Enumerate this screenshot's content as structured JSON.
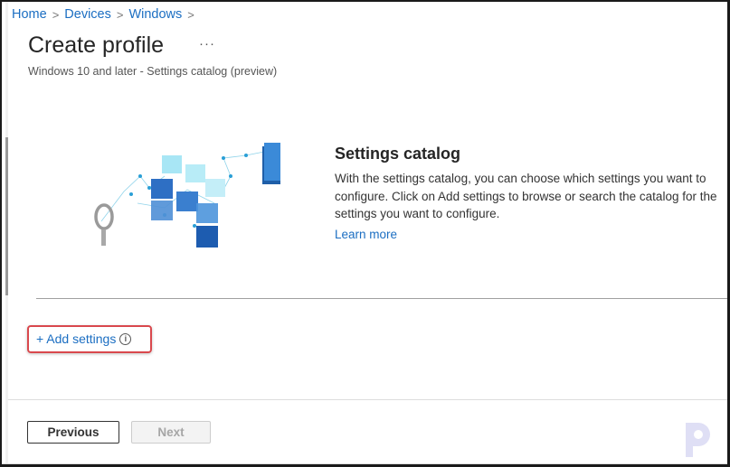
{
  "breadcrumb": {
    "items": [
      "Home",
      "Devices",
      "Windows"
    ],
    "separator": ">"
  },
  "header": {
    "title": "Create profile",
    "more_label": "···",
    "subtitle": "Windows 10 and later - Settings catalog (preview)"
  },
  "catalog": {
    "illustration": "settings-catalog-illustration",
    "title": "Settings catalog",
    "description": "With the settings catalog, you can choose which settings you want to configure. Click on Add settings to browse or search the catalog for the settings you want to configure.",
    "learn_more": "Learn more"
  },
  "add_settings": {
    "label": "+ Add settings",
    "info_icon": "i"
  },
  "footer": {
    "previous_label": "Previous",
    "next_label": "Next"
  },
  "colors": {
    "link": "#1b6ec2",
    "highlight": "#d9484d"
  }
}
